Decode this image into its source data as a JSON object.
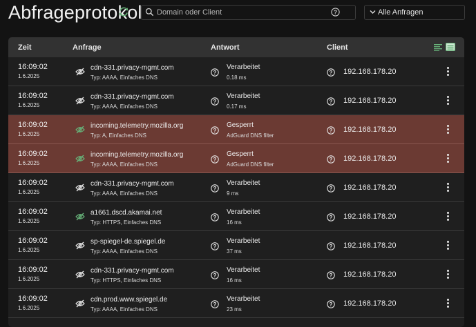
{
  "header": {
    "title": "Abfrageprotokoll",
    "search_placeholder": "Domain oder Client",
    "filter_label": "Alle Anfragen"
  },
  "table": {
    "columns": [
      "Zeit",
      "Anfrage",
      "Antwort",
      "Client"
    ],
    "rows": [
      {
        "time": "16:09:02",
        "date": "1.6.2025",
        "domain": "cdn-331.privacy-mgmt.com",
        "type": "Typ: AAAA, Einfaches DNS",
        "status": "Verarbeitet",
        "detail": "0.18 ms",
        "client": "192.168.178.20",
        "blocked": false
      },
      {
        "time": "16:09:02",
        "date": "1.6.2025",
        "domain": "cdn-331.privacy-mgmt.com",
        "type": "Typ: AAAA, Einfaches DNS",
        "status": "Verarbeitet",
        "detail": "0.17 ms",
        "client": "192.168.178.20",
        "blocked": false
      },
      {
        "time": "16:09:02",
        "date": "1.6.2025",
        "domain": "incoming.telemetry.mozilla.org",
        "type": "Typ: A, Einfaches DNS",
        "status": "Gesperrt",
        "detail": "AdGuard DNS filter",
        "client": "192.168.178.20",
        "blocked": true
      },
      {
        "time": "16:09:02",
        "date": "1.6.2025",
        "domain": "incoming.telemetry.mozilla.org",
        "type": "Typ: AAAA, Einfaches DNS",
        "status": "Gesperrt",
        "detail": "AdGuard DNS filter",
        "client": "192.168.178.20",
        "blocked": true
      },
      {
        "time": "16:09:02",
        "date": "1.6.2025",
        "domain": "cdn-331.privacy-mgmt.com",
        "type": "Typ: AAAA, Einfaches DNS",
        "status": "Verarbeitet",
        "detail": "9 ms",
        "client": "192.168.178.20",
        "blocked": false
      },
      {
        "time": "16:09:02",
        "date": "1.6.2025",
        "domain": "a1661.dscd.akamai.net",
        "type": "Typ: HTTPS, Einfaches DNS",
        "status": "Verarbeitet",
        "detail": "16 ms",
        "client": "192.168.178.20",
        "blocked": false,
        "green_eye": true
      },
      {
        "time": "16:09:02",
        "date": "1.6.2025",
        "domain": "sp-spiegel-de.spiegel.de",
        "type": "Typ: AAAA, Einfaches DNS",
        "status": "Verarbeitet",
        "detail": "37 ms",
        "client": "192.168.178.20",
        "blocked": false
      },
      {
        "time": "16:09:02",
        "date": "1.6.2025",
        "domain": "cdn-331.privacy-mgmt.com",
        "type": "Typ: HTTPS, Einfaches DNS",
        "status": "Verarbeitet",
        "detail": "16 ms",
        "client": "192.168.178.20",
        "blocked": false
      },
      {
        "time": "16:09:02",
        "date": "1.6.2025",
        "domain": "cdn.prod.www.spiegel.de",
        "type": "Typ: AAAA, Einfaches DNS",
        "status": "Verarbeitet",
        "detail": "23 ms",
        "client": "192.168.178.20",
        "blocked": false
      }
    ]
  },
  "colors": {
    "background": "#131313",
    "card": "#1f1f1f",
    "header_row": "#323232",
    "blocked_row": "#6b3a33",
    "accent_green": "#67b279"
  },
  "icons": {
    "refresh": "refresh-icon",
    "search": "search-icon",
    "help": "question-circle-icon",
    "filter": "chevron-down-icon",
    "visibility": "eye-off-icon",
    "menu": "kebab-menu-icon",
    "compact_view": "list-view-icon",
    "table_view": "table-view-icon"
  }
}
